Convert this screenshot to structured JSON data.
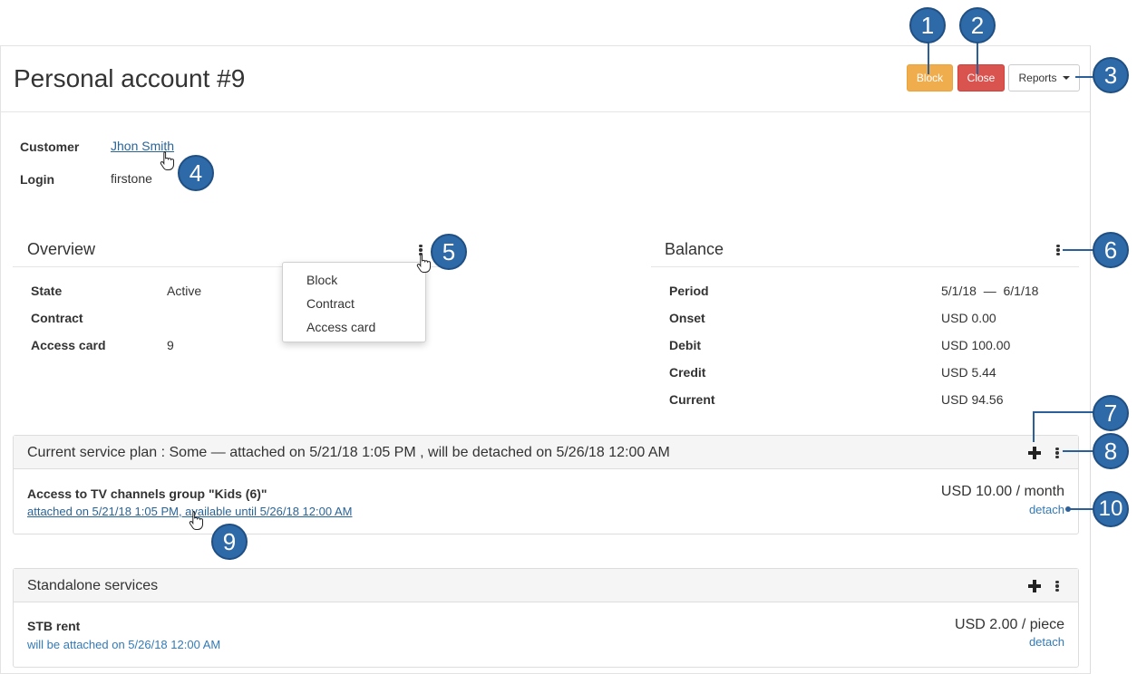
{
  "header": {
    "title": "Personal account #9",
    "block_label": "Block",
    "close_label": "Close",
    "reports_label": "Reports"
  },
  "account": {
    "customer_label": "Customer",
    "customer_value": "Jhon Smith",
    "login_label": "Login",
    "login_value": "firstone"
  },
  "overview": {
    "title": "Overview",
    "rows": [
      {
        "label": "State",
        "value": "Active"
      },
      {
        "label": "Contract",
        "value": ""
      },
      {
        "label": "Access card",
        "value": "9"
      }
    ],
    "menu": [
      "Block",
      "Contract",
      "Access card"
    ]
  },
  "balance": {
    "title": "Balance",
    "rows": [
      {
        "label": "Period",
        "value": "5/1/18  —  6/1/18"
      },
      {
        "label": "Onset",
        "value": "USD 0.00"
      },
      {
        "label": "Debit",
        "value": "USD 100.00"
      },
      {
        "label": "Credit",
        "value": "USD 5.44"
      },
      {
        "label": "Current",
        "value": "USD 94.56"
      }
    ]
  },
  "service_plan": {
    "header": "Current service plan : Some —  attached on  5/21/18 1:05 PM , will be detached on  5/26/18 12:00 AM",
    "item_name": "Access to TV channels group \"Kids (6)\"",
    "item_sub": "attached on 5/21/18 1:05 PM, available until 5/26/18 12:00 AM",
    "item_price": "USD 10.00 / month",
    "item_action": "detach"
  },
  "standalone": {
    "header": "Standalone services",
    "item_name": "STB rent",
    "item_sub": "will be attached on 5/26/18 12:00 AM",
    "item_price": "USD 2.00 / piece",
    "item_action": "detach"
  },
  "callouts": [
    "1",
    "2",
    "3",
    "4",
    "5",
    "6",
    "7",
    "8",
    "9",
    "10"
  ],
  "colors": {
    "block_button": "#f0ad4e",
    "close_button": "#d9534f",
    "link": "#337ab7",
    "callout": "#2f6aa8"
  }
}
